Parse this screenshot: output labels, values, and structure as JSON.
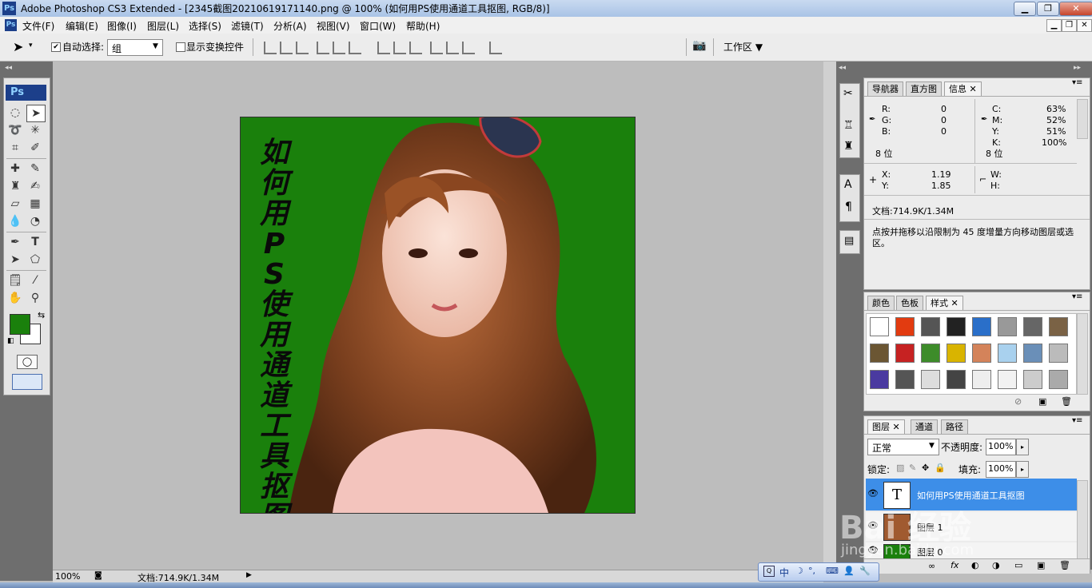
{
  "window": {
    "app_icon": "Ps",
    "title": "Adobe Photoshop CS3 Extended - [2345截图20210619171140.png @ 100% (如何用PS使用通道工具抠图, RGB/8)]",
    "min_label": "▁",
    "max_label": "❐",
    "close_label": "✕"
  },
  "menu": {
    "items": [
      "文件(F)",
      "编辑(E)",
      "图像(I)",
      "图层(L)",
      "选择(S)",
      "滤镜(T)",
      "分析(A)",
      "视图(V)",
      "窗口(W)",
      "帮助(H)"
    ],
    "doc_buttons": [
      "▁",
      "❐",
      "✕"
    ]
  },
  "options": {
    "auto_select_label": "自动选择:",
    "auto_select_checked": "✔",
    "group_value": "组",
    "show_transform_label": "显示变换控件",
    "workspace_label": "工作区 ▼"
  },
  "toolbox": {
    "ps_logo": "Ps",
    "foreground_color": "#1a800c",
    "background_color": "#ffffff"
  },
  "canvas": {
    "vertical_text": [
      "如",
      "何",
      "用",
      "P",
      "S",
      "使",
      "用",
      "通",
      "道",
      "工",
      "具",
      "抠",
      "图"
    ],
    "bg_color": "#1a800c"
  },
  "info_panel": {
    "tabs": [
      "导航器",
      "直方图",
      "信息"
    ],
    "active_tab": "信息",
    "r_label": "R:",
    "r_value": "0",
    "g_label": "G:",
    "g_value": "0",
    "b_label": "B:",
    "b_value": "0",
    "c_label": "C:",
    "c_value": "63%",
    "m_label": "M:",
    "m_value": "52%",
    "y_label": "Y:",
    "y_value": "51%",
    "k_label": "K:",
    "k_value": "100%",
    "bits_left": "8 位",
    "bits_right": "8 位",
    "x_label": "X:",
    "x_value": "1.19",
    "ypos_label": "Y:",
    "ypos_value": "1.85",
    "w_label": "W:",
    "h_label": "H:",
    "doc_size": "文档:714.9K/1.34M",
    "hint": "点按并拖移以沿限制为 45 度增量方向移动图层或选区。"
  },
  "styles_panel": {
    "tabs": [
      "颜色",
      "色板",
      "样式"
    ],
    "active_tab": "样式"
  },
  "layers_panel": {
    "tabs": [
      "图层",
      "通道",
      "路径"
    ],
    "active_tab": "图层",
    "blend_mode": "正常",
    "opacity_label": "不透明度:",
    "opacity_value": "100%",
    "lock_label": "锁定:",
    "fill_label": "填充:",
    "fill_value": "100%",
    "layers": [
      {
        "name": "如何用PS使用通道工具抠图",
        "thumb": "T",
        "selected": true
      },
      {
        "name": "图层 1",
        "thumb": "",
        "selected": false
      },
      {
        "name": "图层 0",
        "thumb": "",
        "selected": false
      }
    ],
    "footer_icons": [
      "∞",
      "fx",
      "◐",
      "◑",
      "▭",
      "▣",
      "🗑"
    ]
  },
  "status": {
    "zoom": "100%",
    "doc_size": "文档:714.9K/1.34M",
    "arrow": "▶"
  },
  "ime_bar": {
    "items": [
      "中",
      "☽",
      "°,",
      "⌨",
      "👤",
      "🔧"
    ]
  },
  "watermark": {
    "line1": "Bai 经验",
    "line2": "jingyan.baidu.com"
  }
}
